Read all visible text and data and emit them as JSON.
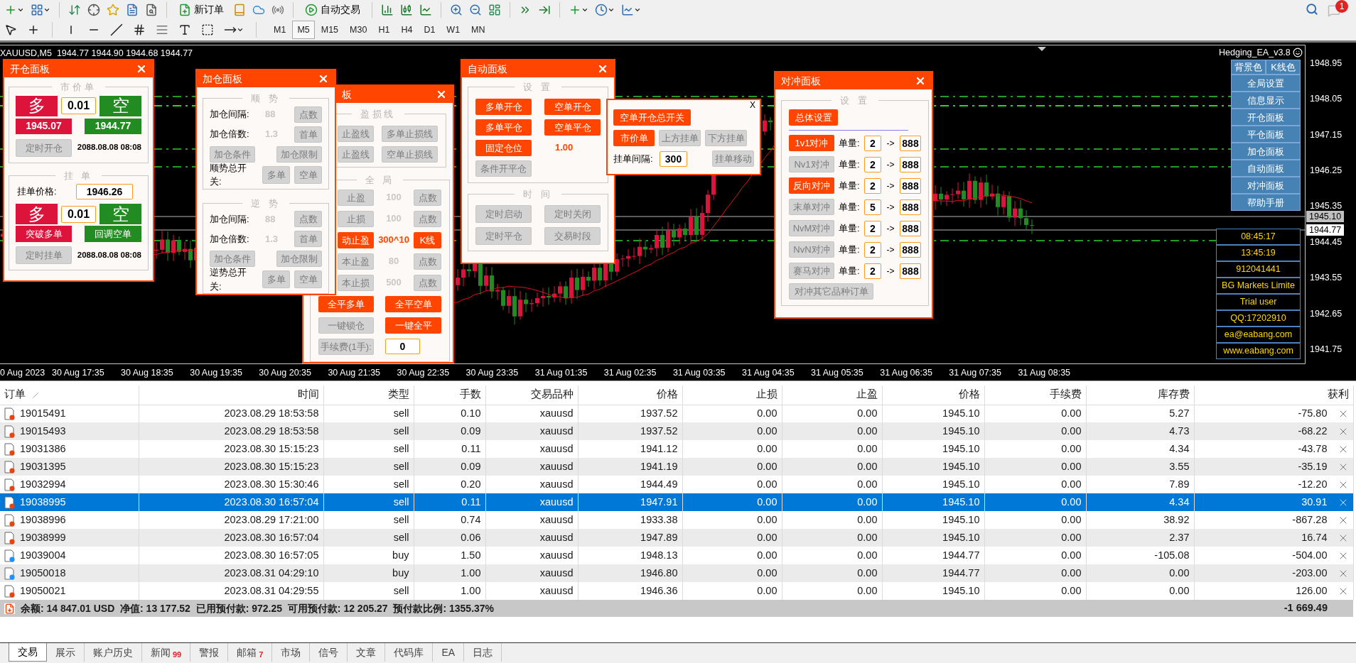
{
  "toolbar": {
    "new_order": "新订单",
    "auto_trading": "自动交易",
    "notifications": "1",
    "timeframes": [
      {
        "label": "M1",
        "selected": false
      },
      {
        "label": "M5",
        "selected": true
      },
      {
        "label": "M15",
        "selected": false
      },
      {
        "label": "M30",
        "selected": false
      },
      {
        "label": "H1",
        "selected": false
      },
      {
        "label": "H4",
        "selected": false
      },
      {
        "label": "D1",
        "selected": false
      },
      {
        "label": "W1",
        "selected": false
      },
      {
        "label": "MN",
        "selected": false
      }
    ]
  },
  "chart": {
    "title": "XAUUSD,M5  1944.77 1944.90 1944.68 1944.77",
    "price_ticks": [
      "1948.95",
      "1948.05",
      "1947.15",
      "1946.25",
      "1945.35",
      "1944.45",
      "1943.55",
      "1942.65",
      "1941.75"
    ],
    "ask_label": "1945.10",
    "bid_label": "1944.77",
    "time_labels": [
      "0 Aug 2023",
      "30 Aug 17:35",
      "30 Aug 18:35",
      "30 Aug 19:35",
      "30 Aug 20:35",
      "30 Aug 21:35",
      "30 Aug 22:35",
      "30 Aug 23:35",
      "31 Aug 01:35",
      "31 Aug 02:35",
      "31 Aug 03:35",
      "31 Aug 04:35",
      "31 Aug 05:35",
      "31 Aug 06:35",
      "31 Aug 07:35",
      "31 Aug 08:35"
    ],
    "ea_name": "Hedging_EA_v3.8",
    "color_buttons": [
      "背景色",
      "K线色"
    ],
    "menu": [
      "全局设置",
      "信息显示",
      "开仓面板",
      "平仓面板",
      "加仓面板",
      "自动面板",
      "对冲面板",
      "帮助手册"
    ],
    "info": [
      "08:45:17",
      "13:45:19",
      "912041441",
      "BG Markets Limite",
      "Trial user",
      "QQ:17202910",
      "ea@eabang.com",
      "www.eabang.com"
    ]
  },
  "open_panel": {
    "title": "开仓面板",
    "market": {
      "legend": "市价单",
      "buy": "多",
      "lot": "0.01",
      "sell": "空",
      "buy_price": "1945.07",
      "sell_price": "1944.77",
      "timer": {
        "label": "定时开仓",
        "on": false
      },
      "timer_value": "2088.08.08 08:08"
    },
    "pending": {
      "legend": "挂 单",
      "price_label": "挂单价格:",
      "price": "1946.26",
      "buy": "多",
      "lot": "0.01",
      "sell": "空",
      "breakout": "突破多单",
      "pullback": "回调空单",
      "timer": {
        "label": "定时挂单",
        "on": false
      },
      "timer_value": "2088.08.08 08:08"
    }
  },
  "add_panel": {
    "title": "加仓面板",
    "sections": [
      {
        "legend": "顺 势",
        "interval_label": "加仓间隔:",
        "interval": "88",
        "points": {
          "label": "点数",
          "on": false
        },
        "multiplier_label": "加仓倍数:",
        "multiplier": "1.3",
        "first": {
          "label": "首单",
          "on": false
        },
        "condition": {
          "label": "加仓条件",
          "on": false
        },
        "limit": {
          "label": "加仓限制",
          "on": false
        },
        "switch_label": "顺势总开关:",
        "buy": {
          "label": "多单",
          "on": false
        },
        "sell": {
          "label": "空单",
          "on": false
        }
      },
      {
        "legend": "逆 势",
        "interval_label": "加仓间隔:",
        "interval": "88",
        "points": {
          "label": "点数",
          "on": false
        },
        "multiplier_label": "加仓倍数:",
        "multiplier": "1.3",
        "first": {
          "label": "首单",
          "on": false
        },
        "condition": {
          "label": "加仓条件",
          "on": false
        },
        "limit": {
          "label": "加仓限制",
          "on": false
        },
        "switch_label": "逆势总开关:",
        "buy": {
          "label": "多单",
          "on": false
        },
        "sell": {
          "label": "空单",
          "on": false
        }
      }
    ]
  },
  "close_panel": {
    "title": "板",
    "lines_legend": "盈损线",
    "line_buttons": [
      [
        {
          "label": "止盈线",
          "on": false
        },
        {
          "label": "多单止损线",
          "on": false
        }
      ],
      [
        {
          "label": "止盈线",
          "on": false
        },
        {
          "label": "空单止损线",
          "on": false
        }
      ]
    ],
    "global_legend": "全 局",
    "global_rows": [
      {
        "button": {
          "label": "止盈",
          "on": false
        },
        "value": "100",
        "unit": {
          "label": "点数",
          "on": false
        }
      },
      {
        "button": {
          "label": "止损",
          "on": false
        },
        "value": "100",
        "unit": {
          "label": "点数",
          "on": false
        }
      },
      {
        "button": {
          "label": "动止盈",
          "on": true
        },
        "value": "300^10",
        "unit": {
          "label": "K线",
          "on": true
        }
      },
      {
        "button": {
          "label": "本止盈",
          "on": false
        },
        "value": "80",
        "unit": {
          "label": "点数",
          "on": false
        }
      },
      {
        "button": {
          "label": "本止损",
          "on": false
        },
        "value": "500",
        "unit": {
          "label": "点数",
          "on": false
        }
      }
    ],
    "close_buttons": [
      [
        {
          "label": "全平多单",
          "on": true
        },
        {
          "label": "全平空单",
          "on": true
        }
      ],
      [
        {
          "label": "一键锁仓",
          "on": false
        },
        {
          "label": "一键全平",
          "on": true
        }
      ]
    ],
    "fee_button": {
      "label": "手续费(1手):",
      "on": false
    },
    "fee": "0"
  },
  "auto_panel": {
    "title": "自动面板",
    "settings_legend": "设 置",
    "buttons": [
      [
        {
          "label": "多单开仓",
          "on": true
        },
        {
          "label": "空单开仓",
          "on": true
        }
      ],
      [
        {
          "label": "多单平仓",
          "on": true
        },
        {
          "label": "空单平仓",
          "on": true
        }
      ]
    ],
    "fixed": {
      "label": "固定仓位",
      "on": true
    },
    "fixed_value": "1.00",
    "condition": {
      "label": "条件开平仓",
      "on": false
    },
    "time_legend": "时 间",
    "time_buttons": [
      [
        {
          "label": "定时启动",
          "on": false
        },
        {
          "label": "定时关闭",
          "on": false
        }
      ],
      [
        {
          "label": "定时平仓",
          "on": false
        },
        {
          "label": "交易时段",
          "on": false
        }
      ]
    ]
  },
  "popup": {
    "close": "X",
    "master": {
      "label": "空单开仓总开关",
      "on": true
    },
    "modes": [
      {
        "label": "市价单",
        "on": true
      },
      {
        "label": "上方挂单",
        "on": false
      },
      {
        "label": "下方挂单",
        "on": false
      }
    ],
    "interval_label": "挂单间隔:",
    "interval": "300",
    "move": {
      "label": "挂单移动",
      "on": false
    }
  },
  "hedge_panel": {
    "title": "对冲面板",
    "legend": "设 置",
    "overall": {
      "label": "总体设置",
      "on": true
    },
    "rows": [
      {
        "button": {
          "label": "1v1对冲",
          "on": true
        },
        "qty_label": "单量:",
        "from": "2",
        "arrow": "->",
        "to": "888"
      },
      {
        "button": {
          "label": "Nv1对冲",
          "on": false
        },
        "qty_label": "单量:",
        "from": "2",
        "arrow": "->",
        "to": "888"
      },
      {
        "button": {
          "label": "反向对冲",
          "on": true
        },
        "qty_label": "单量:",
        "from": "2",
        "arrow": "->",
        "to": "888"
      },
      {
        "button": {
          "label": "末单对冲",
          "on": false
        },
        "qty_label": "单量:",
        "from": "5",
        "arrow": "->",
        "to": "888"
      },
      {
        "button": {
          "label": "NvM对冲",
          "on": false
        },
        "qty_label": "单量:",
        "from": "2",
        "arrow": "->",
        "to": "888"
      },
      {
        "button": {
          "label": "NvN对冲",
          "on": false
        },
        "qty_label": "单量:",
        "from": "2",
        "arrow": "->",
        "to": "888"
      },
      {
        "button": {
          "label": "赛马对冲",
          "on": false
        },
        "qty_label": "单量:",
        "from": "2",
        "arrow": "->",
        "to": "888"
      }
    ],
    "other": {
      "label": "对冲其它品种订单",
      "on": false
    }
  },
  "table": {
    "columns": [
      "订单",
      "时间",
      "类型",
      "手数",
      "交易品种",
      "价格",
      "止损",
      "止盈",
      "价格",
      "手续费",
      "库存费",
      "获利"
    ],
    "rows": [
      {
        "kind": "sell",
        "selected": false,
        "cells": [
          "19015491",
          "2023.08.29 18:53:58",
          "sell",
          "0.10",
          "xauusd",
          "1937.52",
          "0.00",
          "0.00",
          "1945.10",
          "0.00",
          "5.27",
          "-75.80"
        ]
      },
      {
        "kind": "sell",
        "selected": false,
        "cells": [
          "19015493",
          "2023.08.29 18:53:58",
          "sell",
          "0.09",
          "xauusd",
          "1937.52",
          "0.00",
          "0.00",
          "1945.10",
          "0.00",
          "4.73",
          "-68.22"
        ]
      },
      {
        "kind": "sell",
        "selected": false,
        "cells": [
          "19031386",
          "2023.08.30 15:15:23",
          "sell",
          "0.11",
          "xauusd",
          "1941.12",
          "0.00",
          "0.00",
          "1945.10",
          "0.00",
          "4.34",
          "-43.78"
        ]
      },
      {
        "kind": "sell",
        "selected": false,
        "cells": [
          "19031395",
          "2023.08.30 15:15:23",
          "sell",
          "0.09",
          "xauusd",
          "1941.19",
          "0.00",
          "0.00",
          "1945.10",
          "0.00",
          "3.55",
          "-35.19"
        ]
      },
      {
        "kind": "sell",
        "selected": false,
        "cells": [
          "19032994",
          "2023.08.30 15:30:46",
          "sell",
          "0.20",
          "xauusd",
          "1944.49",
          "0.00",
          "0.00",
          "1945.10",
          "0.00",
          "7.89",
          "-12.20"
        ]
      },
      {
        "kind": "sell",
        "selected": true,
        "cells": [
          "19038995",
          "2023.08.30 16:57:04",
          "sell",
          "0.11",
          "xauusd",
          "1947.91",
          "0.00",
          "0.00",
          "1945.10",
          "0.00",
          "4.34",
          "30.91"
        ]
      },
      {
        "kind": "sell",
        "selected": false,
        "cells": [
          "19038996",
          "2023.08.29 17:21:00",
          "sell",
          "0.74",
          "xauusd",
          "1933.38",
          "0.00",
          "0.00",
          "1945.10",
          "0.00",
          "38.92",
          "-867.28"
        ]
      },
      {
        "kind": "sell",
        "selected": false,
        "cells": [
          "19038999",
          "2023.08.30 16:57:04",
          "sell",
          "0.06",
          "xauusd",
          "1947.89",
          "0.00",
          "0.00",
          "1945.10",
          "0.00",
          "2.37",
          "16.74"
        ]
      },
      {
        "kind": "buy",
        "selected": false,
        "cells": [
          "19039004",
          "2023.08.30 16:57:05",
          "buy",
          "1.50",
          "xauusd",
          "1948.13",
          "0.00",
          "0.00",
          "1944.77",
          "0.00",
          "-105.08",
          "-504.00"
        ]
      },
      {
        "kind": "buy",
        "selected": false,
        "cells": [
          "19050018",
          "2023.08.31 04:29:10",
          "buy",
          "1.00",
          "xauusd",
          "1946.80",
          "0.00",
          "0.00",
          "1944.77",
          "0.00",
          "0.00",
          "-203.00"
        ]
      },
      {
        "kind": "sell",
        "selected": false,
        "cells": [
          "19050021",
          "2023.08.31 04:29:55",
          "sell",
          "1.00",
          "xauusd",
          "1946.36",
          "0.00",
          "0.00",
          "1945.10",
          "0.00",
          "0.00",
          "126.00"
        ]
      }
    ],
    "summary": "余额: 14 847.01 USD  净值: 13 177.52  已用预付款: 972.25  可用预付款: 12 205.27  预付款比例: 1355.37%",
    "total": "-1 669.49"
  },
  "tabs": [
    {
      "label": "交易",
      "selected": true
    },
    {
      "label": "展示",
      "selected": false
    },
    {
      "label": "账户历史",
      "selected": false
    },
    {
      "label": "新闻",
      "badge": "99",
      "selected": false
    },
    {
      "label": "警报",
      "selected": false
    },
    {
      "label": "邮箱",
      "badge": "7",
      "selected": false
    },
    {
      "label": "市场",
      "selected": false
    },
    {
      "label": "信号",
      "selected": false
    },
    {
      "label": "文章",
      "selected": false
    },
    {
      "label": "代码库",
      "selected": false
    },
    {
      "label": "EA",
      "selected": false
    },
    {
      "label": "日志",
      "selected": false
    }
  ]
}
